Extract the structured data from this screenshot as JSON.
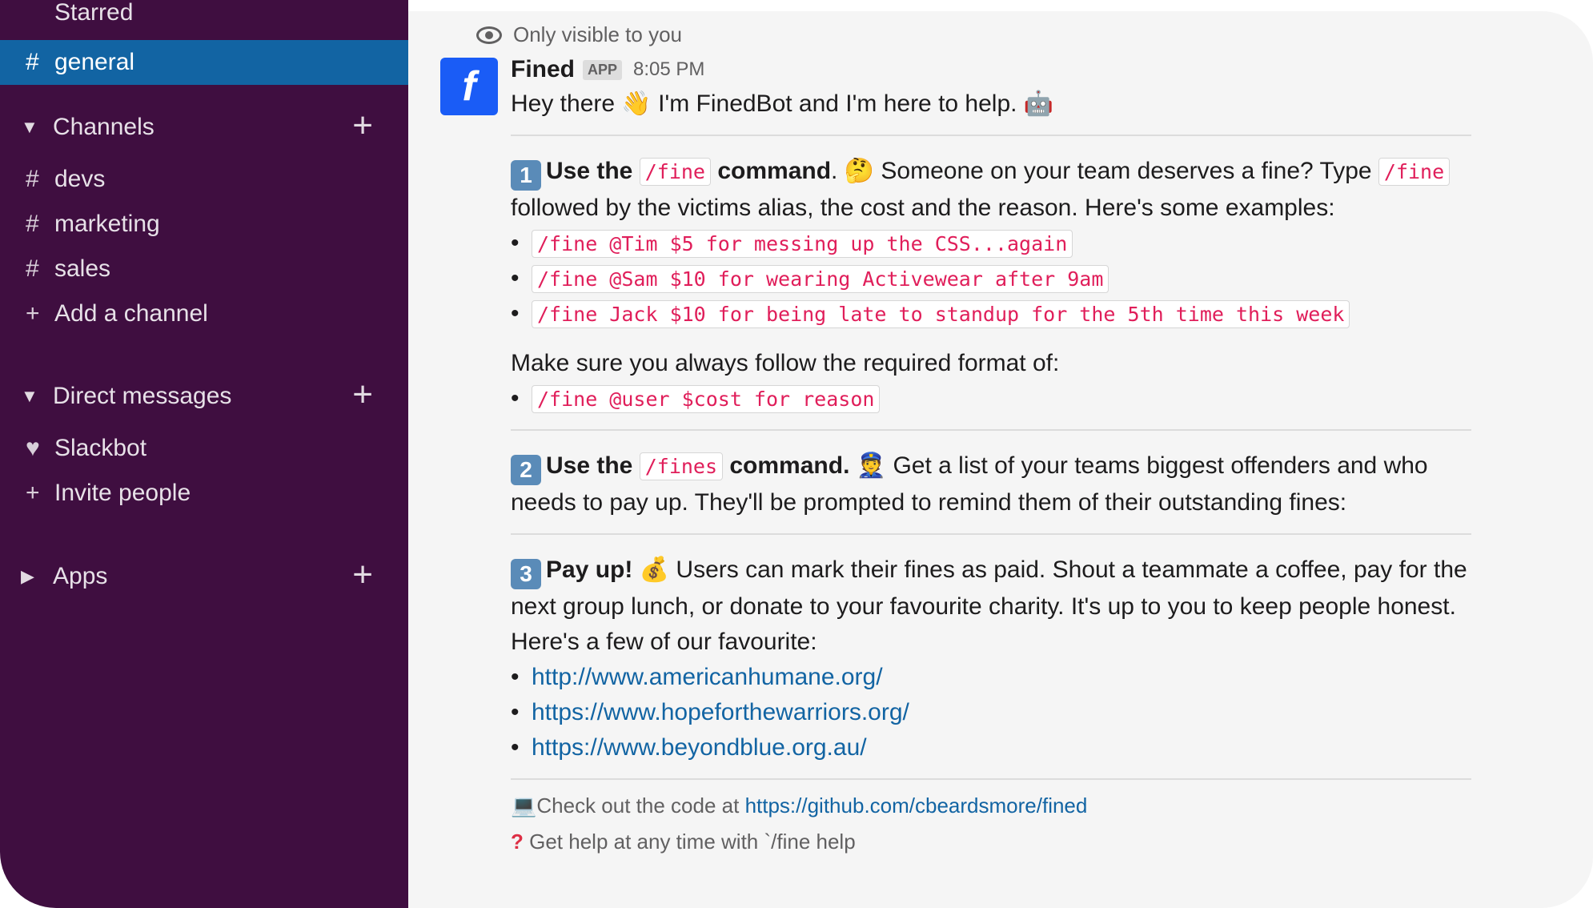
{
  "sidebar": {
    "starred_label": "Starred",
    "active_channel": "general",
    "channels_header": "Channels",
    "channels": [
      "devs",
      "marketing",
      "sales"
    ],
    "add_channel": "Add a channel",
    "dm_header": "Direct messages",
    "dm_slackbot": "Slackbot",
    "invite_people": "Invite people",
    "apps_header": "Apps"
  },
  "message": {
    "visibility": "Only visible to you",
    "sender": "Fined",
    "app_badge": "APP",
    "time": "8:05 PM",
    "avatar_letter": "f",
    "greeting_a": "Hey there",
    "greeting_b": "I'm FinedBot and I'm here to help.",
    "s1_num": "1",
    "s1_a": "Use the",
    "s1_cmd": "/fine",
    "s1_b": "command",
    "s1_c": "Someone on your team deserves a fine? Type",
    "s1_cmd2": "/fine",
    "s1_d": "followed by the victims alias, the cost and the reason. Here's some examples:",
    "examples": [
      "/fine @Tim $5 for messing up the CSS...again",
      "/fine @Sam $10 for wearing Activewear after 9am",
      "/fine Jack $10 for being late to standup for the 5th time this week"
    ],
    "format_intro": "Make sure you always follow the required format of:",
    "format": "/fine @user $cost for reason",
    "s2_num": "2",
    "s2_a": "Use the",
    "s2_cmd": "/fines",
    "s2_b": "command.",
    "s2_c": "Get a list of your teams biggest offenders and who",
    "s2_d": "needs to pay up. They'll be prompted to remind them of their outstanding fines:",
    "s3_num": "3",
    "s3_a": "Pay up!",
    "s3_b": "Users can mark their fines as paid. Shout a teammate a coffee, pay for the",
    "s3_c": "next group lunch, or donate to your favourite charity. It's up to you to keep people honest.",
    "s3_d": "Here's a few of our favourite:",
    "links": [
      "http://www.americanhumane.org/",
      "https://www.hopeforthewarriors.org/",
      "https://www.beyondblue.org.au/"
    ],
    "foot_a": "Check out the code at",
    "foot_link": "https://github.com/cbeardsmore/fined",
    "foot_b": "Get help at any time with `/fine help"
  }
}
